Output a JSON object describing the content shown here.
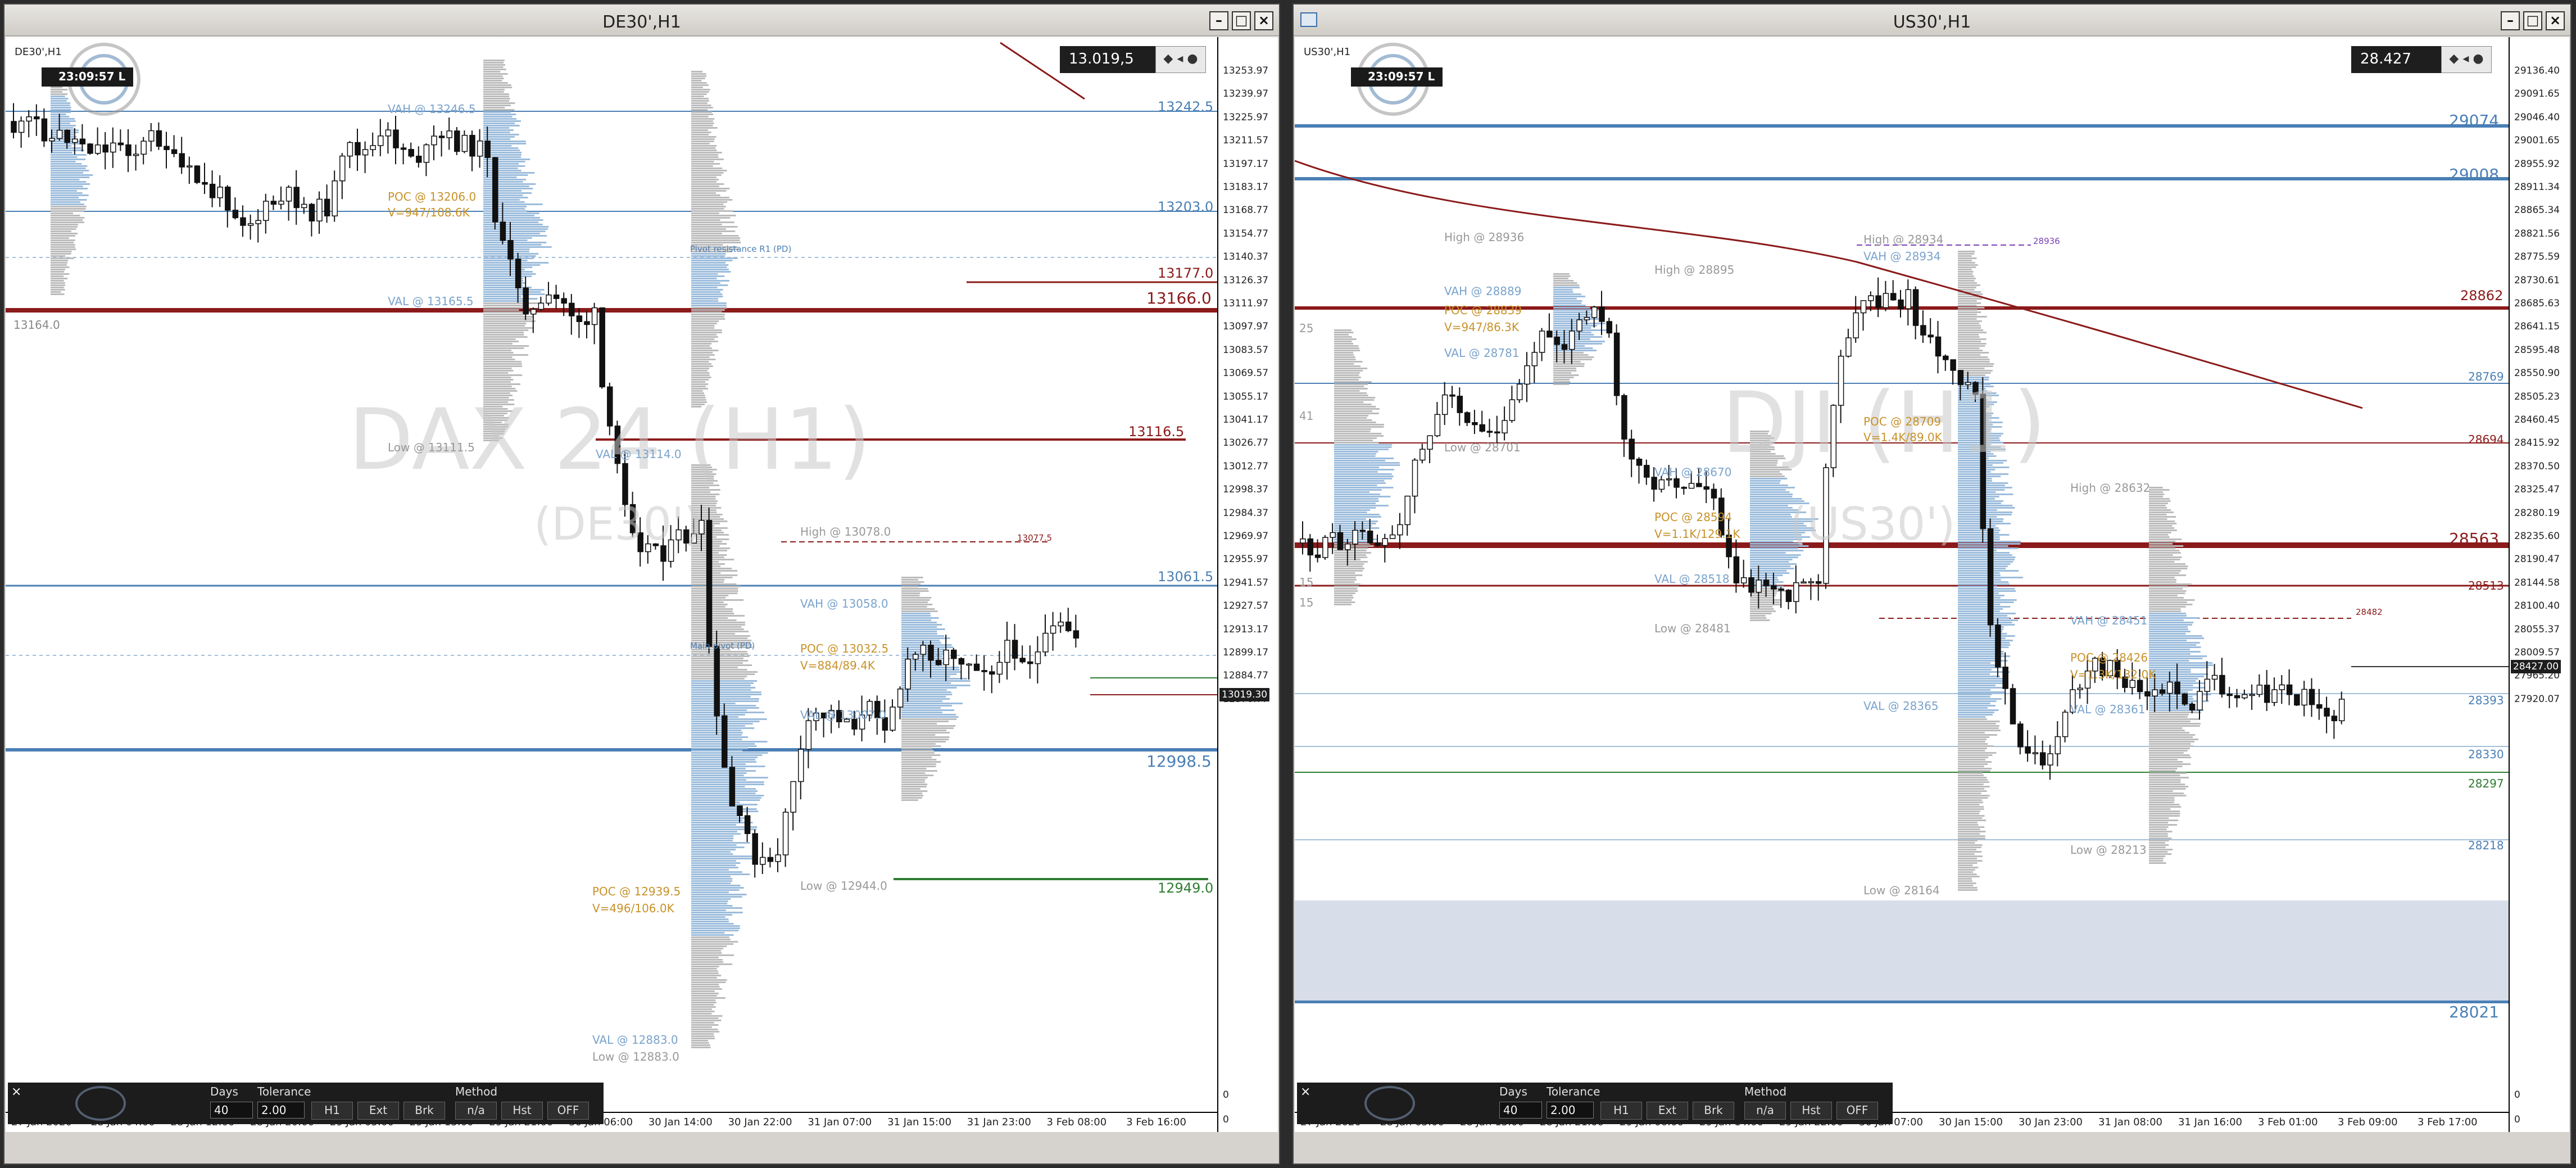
{
  "left": {
    "title": "DE30',H1",
    "symbol_label": "DE30',H1",
    "clock": "23:09:57 L",
    "current_price": "13.019,5",
    "current_price_tag": "13019.30",
    "watermark_main": "DAX 24 (H1)",
    "watermark_sub": "(DE30')",
    "price_labels": [
      "13253.97",
      "13239.97",
      "13225.97",
      "13211.57",
      "13197.17",
      "13183.17",
      "13168.77",
      "13154.77",
      "13140.37",
      "13126.37",
      "13111.97",
      "13097.97",
      "13083.57",
      "13069.57",
      "13055.17",
      "13041.17",
      "13026.77",
      "13012.77",
      "12998.37",
      "12984.37",
      "12969.97",
      "12955.97",
      "12941.57",
      "12927.57",
      "12913.17",
      "12899.17",
      "12884.77",
      "12870.77"
    ],
    "macd_labels": [
      "0",
      "0"
    ],
    "time_labels": [
      "27 Jan 2020",
      "28 Jan 04:00",
      "28 Jan 12:00",
      "28 Jan 20:00",
      "29 Jan 05:00",
      "29 Jan 13:00",
      "29 Jan 21:00",
      "30 Jan 06:00",
      "30 Jan 14:00",
      "30 Jan 22:00",
      "31 Jan 07:00",
      "31 Jan 15:00",
      "31 Jan 23:00",
      "3 Feb 08:00",
      "3 Feb 16:00"
    ],
    "levels": [
      {
        "label": "13242.5",
        "color": "#4a7fb5"
      },
      {
        "label": "13203.0",
        "color": "#4a7fb5"
      },
      {
        "label": "13177.0",
        "color": "#8b1a1a"
      },
      {
        "label": "13166.0",
        "color": "#8b1a1a"
      },
      {
        "label": "13116.5",
        "color": "#8b1a1a"
      },
      {
        "label": "13061.5",
        "color": "#4a7fb5"
      },
      {
        "label": "12998.5",
        "color": "#4a7fb5"
      },
      {
        "label": "12949.0",
        "color": "#2e7d32"
      }
    ],
    "profile_labels": {
      "vah1": "VAH @ 13246.5",
      "poc1": "POC @ 13206.0",
      "v1": "V=947/108.6K",
      "val1": "VAL @ 13165.5",
      "low_left": "13164.0",
      "low1": "Low @ 13111.5",
      "val2": "VAL @ 13114.0",
      "pivot_r1": "Pivot resistance R1 (PD)",
      "high2": "High @ 13078.0",
      "h_tag": "13077.5",
      "vah2": "VAH @ 13058.0",
      "main_pivot": "Main pivot (PD)",
      "poc2": "POC @ 13032.5",
      "v2": "V=884/89.4K",
      "val3": "VAL @ 13007.0",
      "low2": "Low @ 12944.0",
      "poc3": "POC @ 12939.5",
      "v3": "V=496/106.0K",
      "val4": "VAL @ 12883.0",
      "low3": "Low @ 12883.0"
    },
    "panel": {
      "days_label": "Days",
      "days_value": "40",
      "tolerance_label": "Tolerance",
      "tolerance_value": "2.00",
      "method_label": "Method",
      "btn_h1": "H1",
      "btn_ext": "Ext",
      "btn_brk": "Brk",
      "btn_na": "n/a",
      "btn_hst": "Hst",
      "btn_off": "OFF",
      "close": "×"
    }
  },
  "right": {
    "title": "US30',H1",
    "symbol_label": "US30',H1",
    "clock": "23:09:57 L",
    "current_price": "28.427",
    "current_price_tag": "28427.00",
    "watermark_main": "DJI (H1)",
    "watermark_sub": "(US30')",
    "price_labels": [
      "29136.40",
      "29091.65",
      "29046.40",
      "29001.65",
      "28955.92",
      "28911.34",
      "28865.34",
      "28821.56",
      "28775.59",
      "28730.61",
      "28685.63",
      "28641.15",
      "28595.48",
      "28550.90",
      "28505.23",
      "28460.45",
      "28415.92",
      "28370.50",
      "28325.47",
      "28280.19",
      "28235.60",
      "28190.47",
      "28144.58",
      "28100.40",
      "28055.37",
      "28009.57",
      "27965.20",
      "27920.07"
    ],
    "macd_labels": [
      "0",
      "0"
    ],
    "time_labels": [
      "27 Jan 2020",
      "28 Jan 05:00",
      "28 Jan 13:00",
      "28 Jan 21:00",
      "29 Jan 06:00",
      "29 Jan 14:00",
      "29 Jan 22:00",
      "30 Jan 07:00",
      "30 Jan 15:00",
      "30 Jan 23:00",
      "31 Jan 08:00",
      "31 Jan 16:00",
      "3 Feb 01:00",
      "3 Feb 09:00",
      "3 Feb 17:00"
    ],
    "levels": [
      {
        "label": "29074",
        "color": "#4a7fb5"
      },
      {
        "label": "29008",
        "color": "#4a7fb5"
      },
      {
        "label": "28862",
        "color": "#8b1a1a"
      },
      {
        "label": "28769",
        "color": "#4a7fb5"
      },
      {
        "label": "28694",
        "color": "#8b1a1a"
      },
      {
        "label": "28563",
        "color": "#8b1a1a"
      },
      {
        "label": "28513",
        "color": "#8b1a1a"
      },
      {
        "label": "28393",
        "color": "#4a7fb5"
      },
      {
        "label": "28330",
        "color": "#4a7fb5"
      },
      {
        "label": "28297",
        "color": "#2e7d32"
      },
      {
        "label": "28218",
        "color": "#4a7fb5"
      },
      {
        "label": "28021",
        "color": "#4a7fb5"
      }
    ],
    "profile_labels": {
      "high1": "High @ 28936",
      "high_top": "High @ 28934",
      "vah_top": "VAH @ 28934",
      "tag_top": "28936",
      "high2": "High @ 28895",
      "vah1": "VAH @ 28889",
      "poc1": "POC @ 28839",
      "v1": "V=947/86.3K",
      "val1": "VAL @ 28781",
      "low1": "Low @ 28701",
      "poc_mid": "POC @ 28709",
      "v_mid": "V=1.4K/89.0K",
      "vah2": "VAH @ 28670",
      "high3": "High @ 28632",
      "poc2": "POC @ 28594",
      "v2": "V=1.1K/129.1K",
      "val2": "VAL @ 28518",
      "low2": "Low @ 28481",
      "tag_482": "28482",
      "vah3": "VAH @ 28451",
      "poc3": "POC @ 28426",
      "v3": "V=1.3K/132.0K",
      "val3": "VAL @ 28365",
      "val4": "VAL @ 28361",
      "low3": "Low @ 28213",
      "low4": "Low @ 28164",
      "side_25": "25",
      "side_41": "41",
      "side_15": "15",
      "side_15b": "15"
    },
    "panel": {
      "days_label": "Days",
      "days_value": "40",
      "tolerance_label": "Tolerance",
      "tolerance_value": "2.00",
      "method_label": "Method",
      "btn_h1": "H1",
      "btn_ext": "Ext",
      "btn_brk": "Brk",
      "btn_na": "n/a",
      "btn_hst": "Hst",
      "btn_off": "OFF",
      "close": "×"
    }
  }
}
